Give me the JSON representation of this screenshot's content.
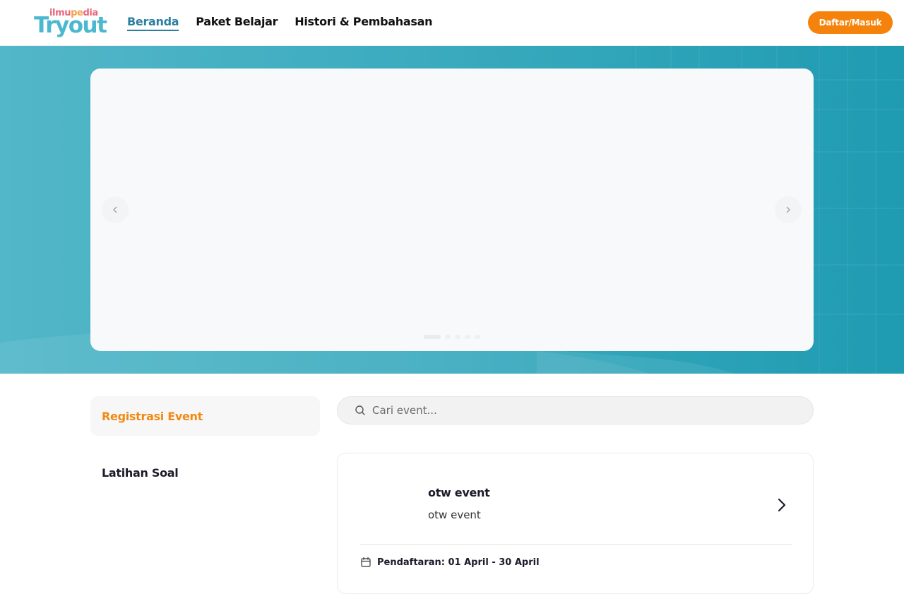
{
  "brand": {
    "small": "ilmupedia",
    "big": "Tryout"
  },
  "nav": {
    "items": [
      {
        "label": "Beranda"
      },
      {
        "label": "Paket Belajar"
      },
      {
        "label": "Histori & Pembahasan"
      }
    ],
    "active_index": 0
  },
  "auth": {
    "login_label": "Daftar/Masuk"
  },
  "carousel": {
    "slide_count": 5,
    "current_slide": 1
  },
  "sidebar": {
    "tabs": [
      {
        "label": "Registrasi Event"
      },
      {
        "label": "Latihan Soal"
      }
    ],
    "active_index": 0
  },
  "search": {
    "placeholder": "Cari event..."
  },
  "events": [
    {
      "title": "otw event",
      "description": "otw event",
      "registration": "Pendaftaran: 01 April - 30 April"
    }
  ],
  "colors": {
    "brand_teal": "#4cb8cf",
    "accent_orange": "#f5820b",
    "nav_active": "#2b7fa0"
  },
  "icons": [
    "search-icon",
    "chevron-left-icon",
    "chevron-right-icon",
    "calendar-icon"
  ]
}
